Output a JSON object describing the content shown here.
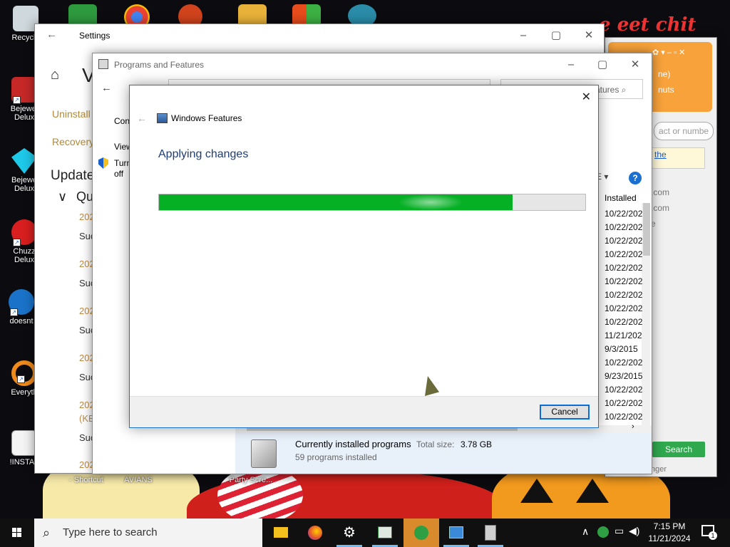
{
  "desktop": {
    "icons": [
      {
        "label": "Recycle"
      },
      {
        "label": "Bejewel Delux"
      },
      {
        "label": "Bejewe Delux"
      },
      {
        "label": "Chuzz Delux"
      },
      {
        "label": "doesnt"
      },
      {
        "label": "Everyth"
      },
      {
        "label": "!INSTAL"
      }
    ],
    "bottom_labels": [
      "- Shortcut",
      "AVIANS",
      "Party Scre..."
    ],
    "wallpaper_text": "e eet chit"
  },
  "settings": {
    "title": "Settings",
    "heading_partial": "V",
    "links": [
      "Uninstall",
      "Recovery"
    ],
    "section": "Update",
    "subsection": "Qu",
    "updates": [
      {
        "date": "202",
        "status": "Suc"
      },
      {
        "date": "202",
        "status": "Suc"
      },
      {
        "date": "202",
        "status": "Suc"
      },
      {
        "date": "202",
        "status": "Suc"
      },
      {
        "date": "202",
        "kb": "(KB",
        "status": "Suc"
      },
      {
        "date": "202",
        "status": ""
      }
    ]
  },
  "chat": {
    "head_line1": "ne)",
    "head_line2": "nuts",
    "search_placeholder": "act or numbe",
    "link": "the",
    "items": [
      ".com",
      ".com",
      "e"
    ],
    "search_button": "Search",
    "footer": "nger"
  },
  "programs": {
    "title": "Programs and Features",
    "search_partial": "atures",
    "left": {
      "control": "Con",
      "view": "View",
      "turn": "Turn",
      "off": "off"
    },
    "column_header": "Installed",
    "dates": [
      "10/22/202",
      "10/22/202",
      "10/22/202",
      "10/22/202",
      "10/22/202",
      "10/22/202",
      "10/22/202",
      "10/22/202",
      "10/22/202",
      "11/21/202",
      "9/3/2015",
      "10/22/202",
      "9/23/2015",
      "10/22/202",
      "10/22/202",
      "10/22/202"
    ],
    "status": {
      "title": "Currently installed programs",
      "size_label": "Total size:",
      "size_value": "3.78 GB",
      "count": "59 programs installed"
    }
  },
  "features_dialog": {
    "title": "Windows Features",
    "heading": "Applying changes",
    "progress": 0.83,
    "cancel": "Cancel"
  },
  "taskbar": {
    "search_placeholder": "Type here to search",
    "time": "7:15 PM",
    "date": "11/21/2024",
    "notification_count": "1"
  },
  "colors": {
    "progress": "#06b025",
    "heading": "#1e3c78",
    "accent": "#0a6cd6"
  }
}
